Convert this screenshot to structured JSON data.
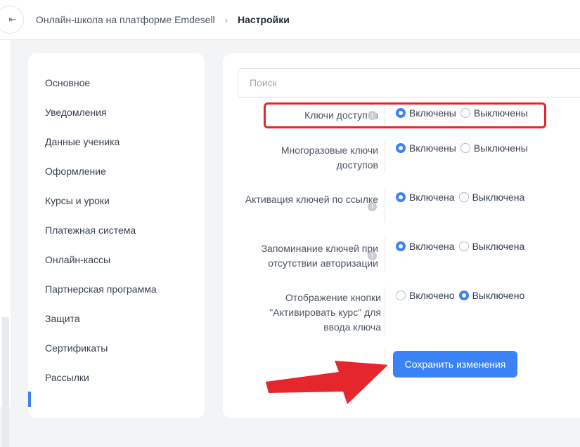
{
  "header": {
    "collapse_icon": "sidebar-collapse-icon",
    "collapse_glyph": "⇤",
    "breadcrumb": {
      "parent": "Онлайн-школа на платформе Emdesell",
      "separator": "›",
      "current": "Настройки"
    }
  },
  "sidebar": {
    "items": [
      {
        "label": "Основное"
      },
      {
        "label": "Уведомления"
      },
      {
        "label": "Данные ученика"
      },
      {
        "label": "Оформление"
      },
      {
        "label": "Курсы и уроки"
      },
      {
        "label": "Платежная система"
      },
      {
        "label": "Онлайн-кассы"
      },
      {
        "label": "Партнерская программа"
      },
      {
        "label": "Защита"
      },
      {
        "label": "Сертификаты"
      },
      {
        "label": "Рассылки"
      }
    ]
  },
  "main": {
    "search": {
      "placeholder": "Поиск",
      "value": ""
    },
    "info_glyph": "!",
    "settings": [
      {
        "label": "Ключи доступов",
        "options": [
          {
            "label": "Включены",
            "checked": true
          },
          {
            "label": "Выключены",
            "checked": false
          }
        ]
      },
      {
        "label": "Многоразовые ключи доступов",
        "options": [
          {
            "label": "Включены",
            "checked": true
          },
          {
            "label": "Выключены",
            "checked": false
          }
        ]
      },
      {
        "label": "Активация ключей по ссылке",
        "options": [
          {
            "label": "Включена",
            "checked": true
          },
          {
            "label": "Выключена",
            "checked": false
          }
        ]
      },
      {
        "label": "Запоминание ключей при отсутствии авторизации",
        "options": [
          {
            "label": "Включена",
            "checked": true
          },
          {
            "label": "Выключена",
            "checked": false
          }
        ]
      },
      {
        "label": "Отображение кнопки \"Активировать курс\" для ввода ключа",
        "options": [
          {
            "label": "Включено",
            "checked": false
          },
          {
            "label": "Выключено",
            "checked": true
          }
        ]
      }
    ],
    "save_label": "Сохранить изменения"
  },
  "colors": {
    "accent": "#3b82f6",
    "annotation_red": "#e5262c"
  }
}
